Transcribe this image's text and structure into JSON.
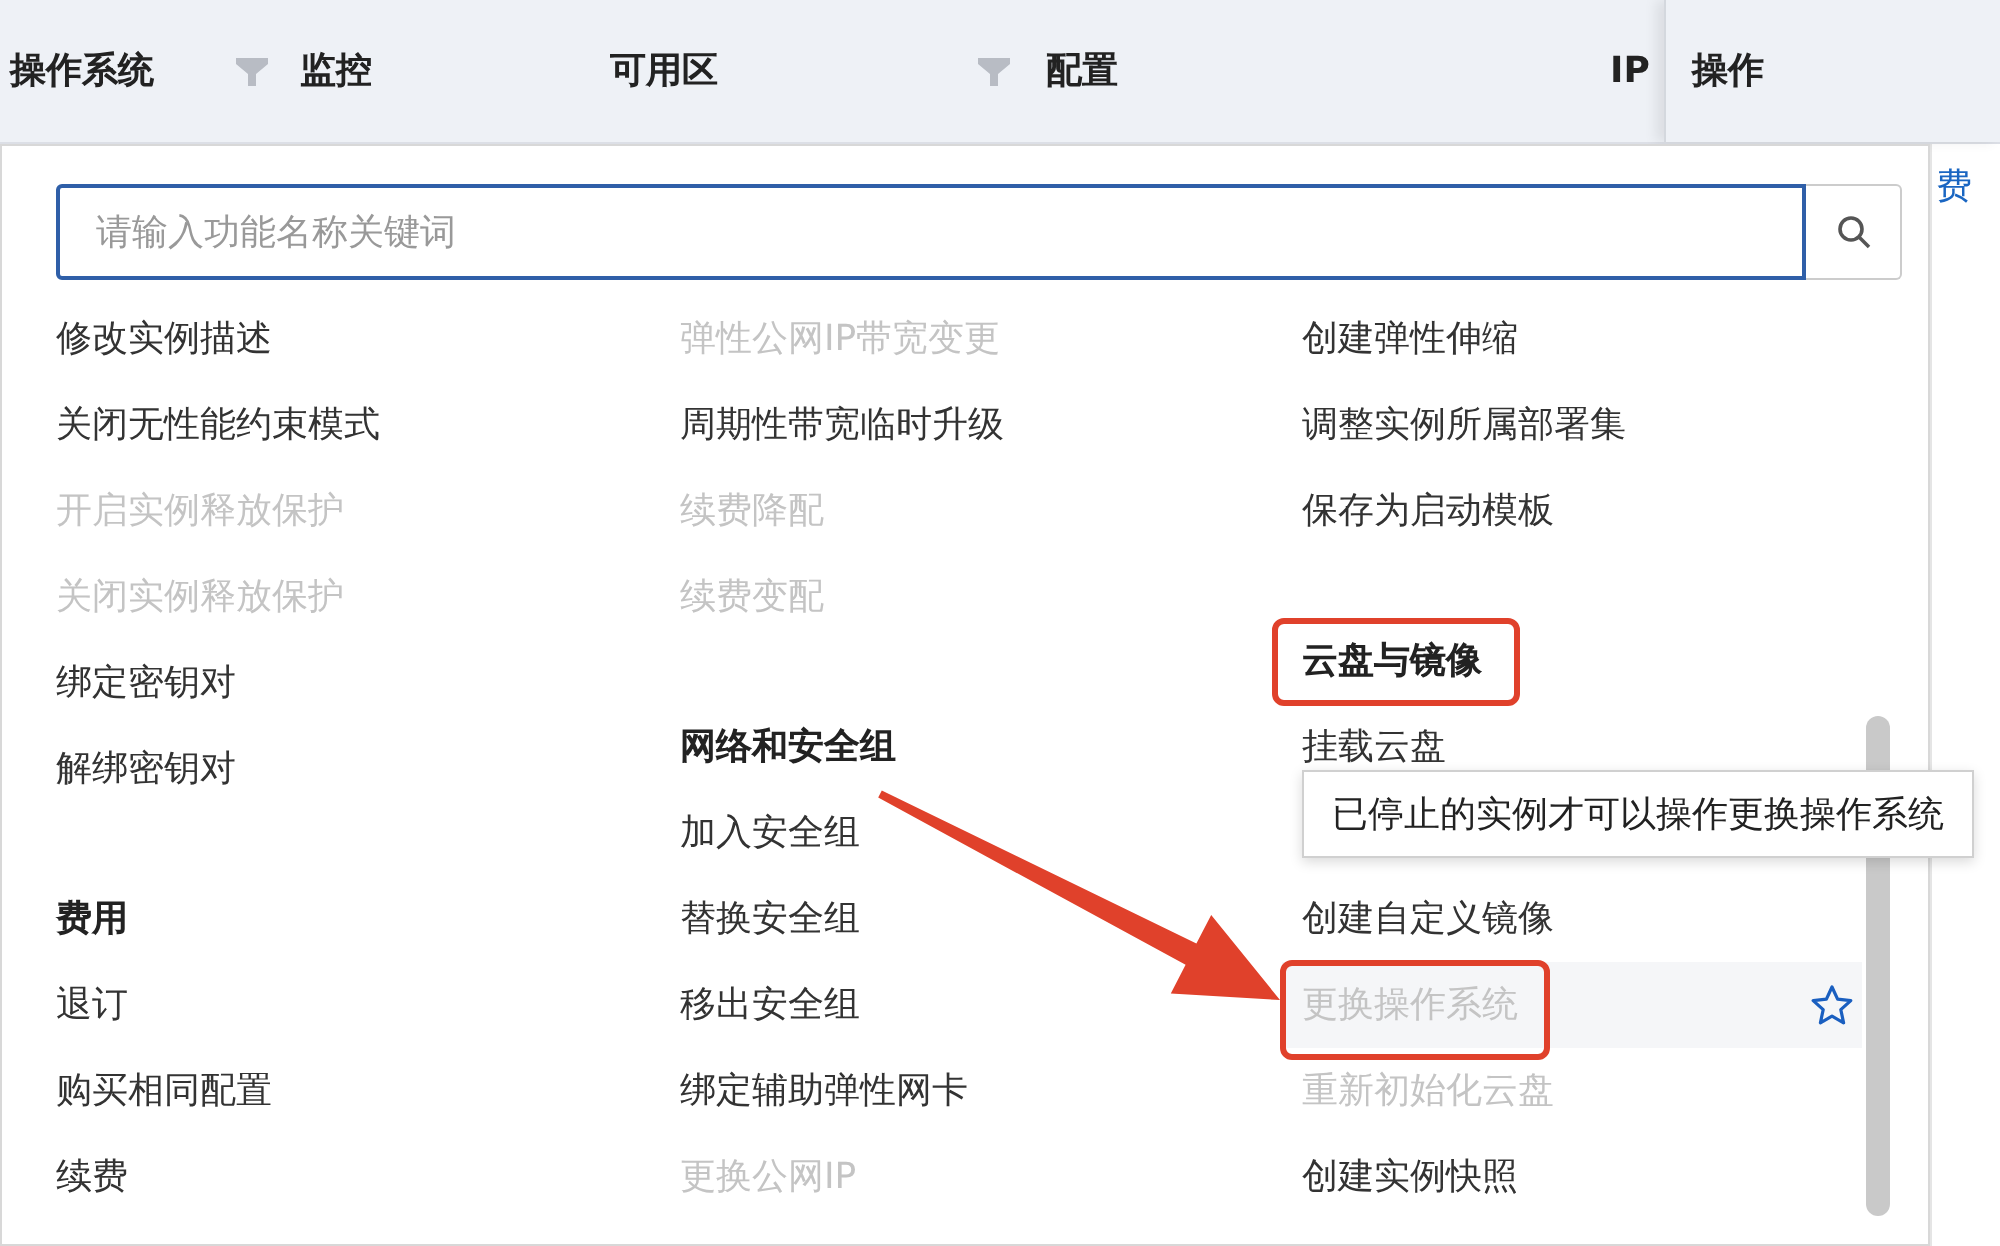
{
  "table_header": {
    "columns": [
      {
        "label": "操作系统",
        "filter": true
      },
      {
        "label": "监控",
        "filter": false
      },
      {
        "label": "可用区",
        "filter": true
      },
      {
        "label": "配置",
        "filter": false
      },
      {
        "label": "IP",
        "filter": false
      }
    ],
    "action_column": "操作"
  },
  "row_action_link": "费",
  "menu": {
    "search": {
      "placeholder": "请输入功能名称关键词"
    },
    "columns": [
      {
        "groups": [
          {
            "items": [
              {
                "label": "修改实例描述",
                "disabled": false,
                "hovered": false
              },
              {
                "label": "关闭无性能约束模式",
                "disabled": false,
                "hovered": false
              },
              {
                "label": "开启实例释放保护",
                "disabled": true,
                "hovered": false
              },
              {
                "label": "关闭实例释放保护",
                "disabled": true,
                "hovered": false
              },
              {
                "label": "绑定密钥对",
                "disabled": false,
                "hovered": false
              },
              {
                "label": "解绑密钥对",
                "disabled": false,
                "hovered": false
              }
            ]
          },
          {
            "heading": "费用",
            "items": [
              {
                "label": "退订",
                "disabled": false,
                "hovered": false
              },
              {
                "label": "购买相同配置",
                "disabled": false,
                "hovered": false
              },
              {
                "label": "续费",
                "disabled": false,
                "hovered": false
              }
            ]
          }
        ]
      },
      {
        "groups": [
          {
            "items": [
              {
                "label": "弹性公网IP带宽变更",
                "disabled": true,
                "hovered": false
              },
              {
                "label": "周期性带宽临时升级",
                "disabled": false,
                "hovered": false
              },
              {
                "label": "续费降配",
                "disabled": true,
                "hovered": false
              },
              {
                "label": "续费变配",
                "disabled": true,
                "hovered": false
              }
            ]
          },
          {
            "heading": "网络和安全组",
            "items": [
              {
                "label": "加入安全组",
                "disabled": false,
                "hovered": false
              },
              {
                "label": "替换安全组",
                "disabled": false,
                "hovered": false
              },
              {
                "label": "移出安全组",
                "disabled": false,
                "hovered": false
              },
              {
                "label": "绑定辅助弹性网卡",
                "disabled": false,
                "hovered": false
              },
              {
                "label": "更换公网IP",
                "disabled": true,
                "hovered": false
              }
            ]
          }
        ]
      },
      {
        "groups": [
          {
            "items": [
              {
                "label": "创建弹性伸缩",
                "disabled": false,
                "hovered": false
              },
              {
                "label": "调整实例所属部署集",
                "disabled": false,
                "hovered": false
              },
              {
                "label": "保存为启动模板",
                "disabled": false,
                "hovered": false
              }
            ]
          },
          {
            "heading": "云盘与镜像",
            "items": [
              {
                "label": "挂载云盘",
                "disabled": false,
                "hovered": false
              },
              {
                "kind": "tooltip",
                "text": "已停止的实例才可以操作更换操作系统"
              },
              {
                "label": "创建自定义镜像",
                "disabled": false,
                "hovered": false
              },
              {
                "label": "更换操作系统",
                "disabled": true,
                "hovered": true
              },
              {
                "label": "重新初始化云盘",
                "disabled": true,
                "hovered": false
              },
              {
                "label": "创建实例快照",
                "disabled": false,
                "hovered": false
              }
            ]
          }
        ]
      }
    ]
  }
}
